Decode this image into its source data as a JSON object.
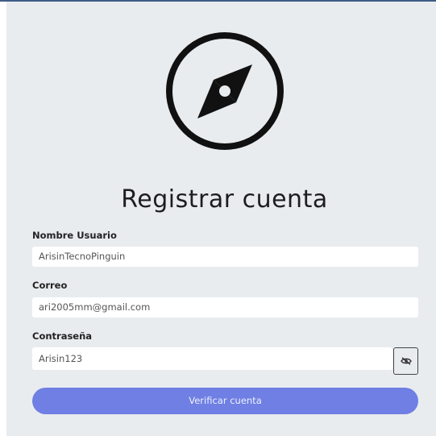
{
  "form": {
    "title": "Registrar cuenta",
    "username": {
      "label": "Nombre Usuario",
      "value": "ArisinTecnoPinguin"
    },
    "email": {
      "label": "Correo",
      "value": "ari2005mm@gmail.com"
    },
    "password": {
      "label": "Contraseña",
      "value": "Arisin123",
      "toggle_icon": "eye-slash-icon"
    },
    "submit_label": "Verificar cuenta"
  },
  "logo_icon": "compass-icon",
  "colors": {
    "panel_background": "#e9ecef",
    "accent_button": "#6f7fe3",
    "top_border": "#3f5b86"
  }
}
